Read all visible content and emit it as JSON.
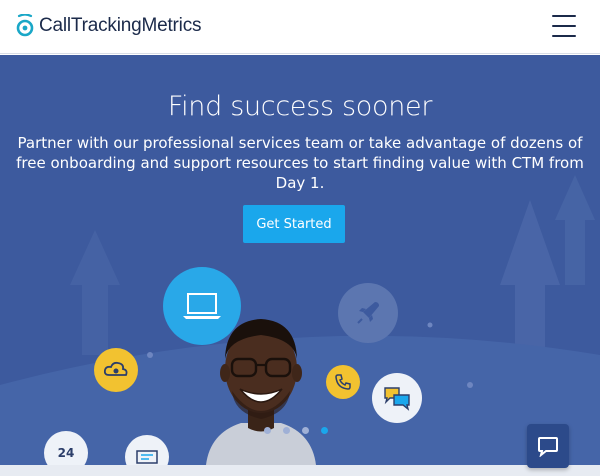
{
  "header": {
    "brand": "CallTrackingMetrics",
    "logo_icon": "ctm-logo-icon",
    "menu_icon": "hamburger-menu-icon"
  },
  "hero": {
    "title": "Find success sooner",
    "description": "Partner with our professional services team or take advantage of dozens of free onboarding and support resources to start finding value with CTM from Day 1.",
    "cta_label": "Get Started",
    "badge_24_7": "24",
    "slides": {
      "count": 4,
      "active_index": 3
    }
  },
  "icons": [
    "laptop-icon",
    "rocket-icon",
    "cloud-location-icon",
    "phone-icon",
    "chat-bubbles-icon",
    "support-24-7-icon",
    "ticket-icon",
    "chat-widget-icon"
  ],
  "colors": {
    "brand_navy": "#1b2a4a",
    "logo_teal": "#1aa7c7",
    "hero_bg": "#3d5a9e",
    "cta_blue": "#1aa7ec",
    "accent_yellow": "#f2c230",
    "chat_widget_bg": "#2c4a8a"
  }
}
